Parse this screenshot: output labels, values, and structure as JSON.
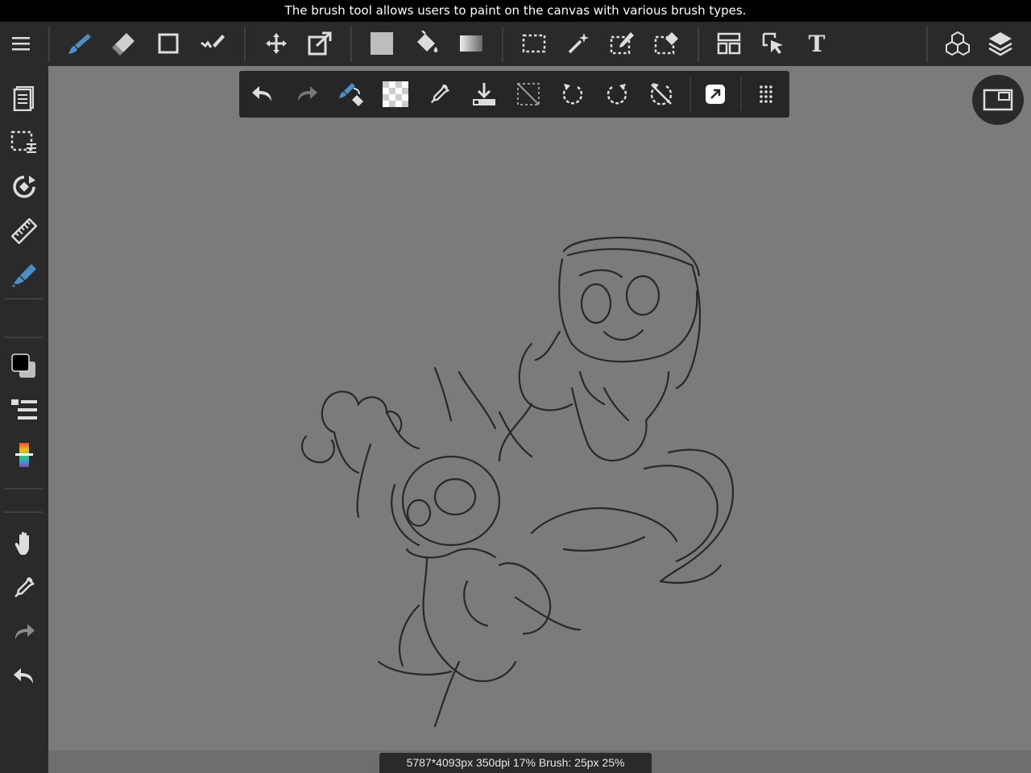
{
  "tooltip": "The brush tool allows users to paint on the canvas with various brush types.",
  "status": {
    "info": "5787*4093px 350dpi 17% Brush: 25px 25%"
  },
  "toolbar": {
    "text_tool_label": "T"
  },
  "icons": {
    "top": [
      "menu-icon",
      "brush-icon",
      "eraser-icon",
      "shape-icon",
      "correction-icon",
      "move-icon",
      "transform-icon",
      "fill-color-icon",
      "bucket-icon",
      "gradient-icon",
      "select-rect-icon",
      "magic-wand-icon",
      "select-pen-icon",
      "select-eraser-icon",
      "frame-icon",
      "operation-icon",
      "text-icon",
      "3d-icon",
      "layers-icon"
    ],
    "sub": [
      "undo-icon",
      "redo-icon",
      "brush-eraser-toggle-icon",
      "transparent-color-icon",
      "eyedropper-icon",
      "save-icon",
      "deselect-icon",
      "rotate-left-icon",
      "rotate-right-icon",
      "reset-rotation-icon",
      "export-icon",
      "more-icon"
    ],
    "left": [
      "pages-icon",
      "selection-layer-icon",
      "rotate-view-icon",
      "ruler-icon",
      "pen-icon",
      "color-swatch-icon",
      "brush-list-icon",
      "color-slider-icon",
      "hand-icon",
      "eyedropper-icon",
      "redo-icon",
      "undo-icon"
    ]
  },
  "colors": {
    "accent": "#4a90c8",
    "toolbar_bg": "#2a2a2a",
    "canvas_bg": "#7b7b7b",
    "foreground_color": "#000000",
    "background_color": "#bdbdbd"
  }
}
